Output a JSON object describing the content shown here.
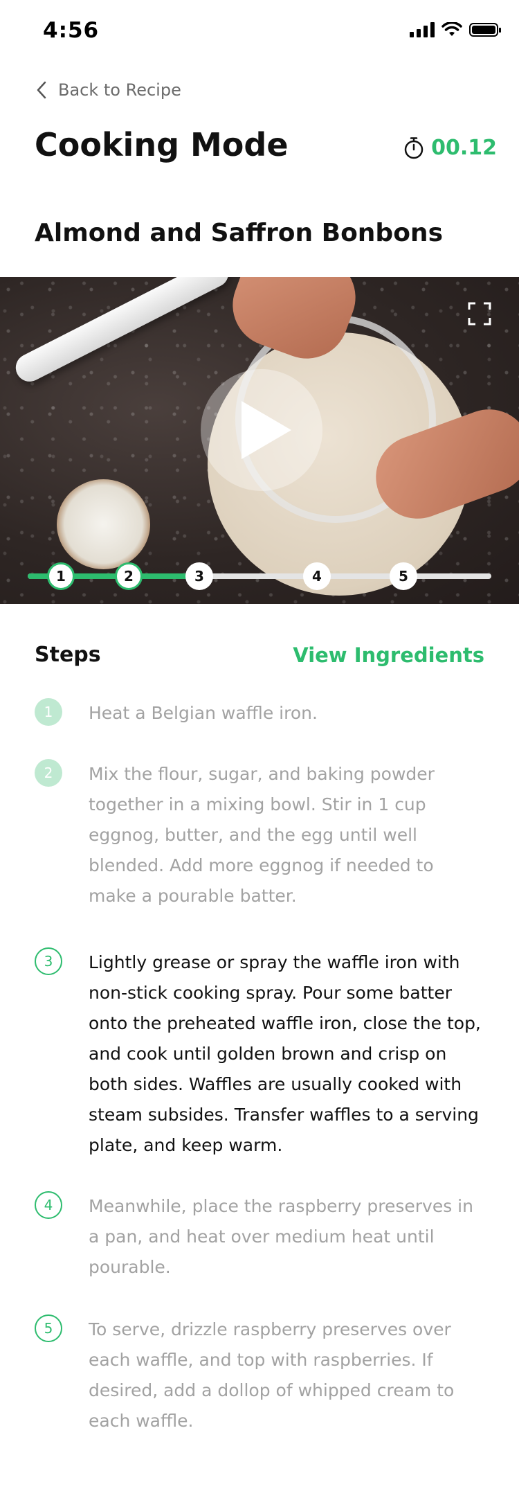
{
  "status_bar": {
    "time": "4:56"
  },
  "nav": {
    "back_label": "Back to Recipe"
  },
  "header": {
    "title": "Cooking Mode",
    "timer": "00.12"
  },
  "recipe": {
    "title": "Almond and Saffron Bonbons"
  },
  "video": {
    "progress_steps": [
      "1",
      "2",
      "3",
      "4",
      "5"
    ],
    "completed_steps": 2,
    "current_step": 3
  },
  "steps_section": {
    "title": "Steps",
    "view_ingredients_label": "View Ingredients"
  },
  "steps": [
    {
      "number": "1",
      "state": "done",
      "text": "Heat a Belgian waffle iron."
    },
    {
      "number": "2",
      "state": "done",
      "text": "Mix the flour, sugar, and baking powder together in a mixing bowl. Stir in 1 cup eggnog, butter, and the egg until well blended. Add more eggnog if needed to make a pourable batter."
    },
    {
      "number": "3",
      "state": "current",
      "text": "Lightly grease or spray the waffle iron with non-stick cooking spray. Pour some batter onto the preheated waffle iron, close the top, and cook until golden brown and crisp on both sides. Waffles are usually cooked with steam subsides. Transfer waffles to a serving plate, and keep warm."
    },
    {
      "number": "4",
      "state": "upcoming",
      "text": "Meanwhile, place the raspberry preserves in a pan, and heat over medium heat until pourable."
    },
    {
      "number": "5",
      "state": "upcoming",
      "text": "To serve, drizzle raspberry preserves over each waffle, and top with raspberries. If desired, add a dollop of whipped cream to each waffle."
    }
  ],
  "colors": {
    "accent": "#2dbc6e",
    "muted_text": "#a2a2a2"
  },
  "icons": [
    "back-chevron-icon",
    "stopwatch-icon",
    "play-icon",
    "fullscreen-icon",
    "signal-icon",
    "wifi-icon",
    "battery-icon"
  ]
}
